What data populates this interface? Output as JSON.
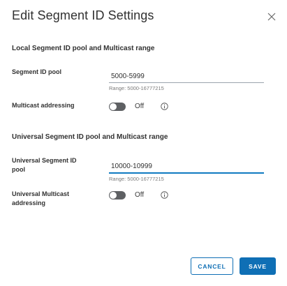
{
  "dialog": {
    "title": "Edit Segment ID Settings",
    "close_icon": "close-icon"
  },
  "local": {
    "heading": "Local Segment ID pool and Multicast range",
    "segment_label": "Segment ID pool",
    "segment_value": "5000-5999",
    "segment_hint": "Range: 5000-16777215",
    "multicast_label": "Multicast addressing",
    "multicast_state": "Off",
    "multicast_on": false,
    "info_icon": "info-icon"
  },
  "universal": {
    "heading": "Universal Segment ID pool and Multicast range",
    "segment_label_line1": "Universal Segment ID",
    "segment_label_line2": "pool",
    "segment_value": "10000-10999",
    "segment_hint": "Range: 5000-16777215",
    "multicast_label_line1": "Universal Multicast",
    "multicast_label_line2": "addressing",
    "multicast_state": "Off",
    "multicast_on": false,
    "info_icon": "info-icon"
  },
  "footer": {
    "cancel_label": "CANCEL",
    "save_label": "SAVE"
  },
  "colors": {
    "accent": "#0f6fb5",
    "focus_underline": "#0f7ac1",
    "toggle_off": "#5e6063"
  }
}
